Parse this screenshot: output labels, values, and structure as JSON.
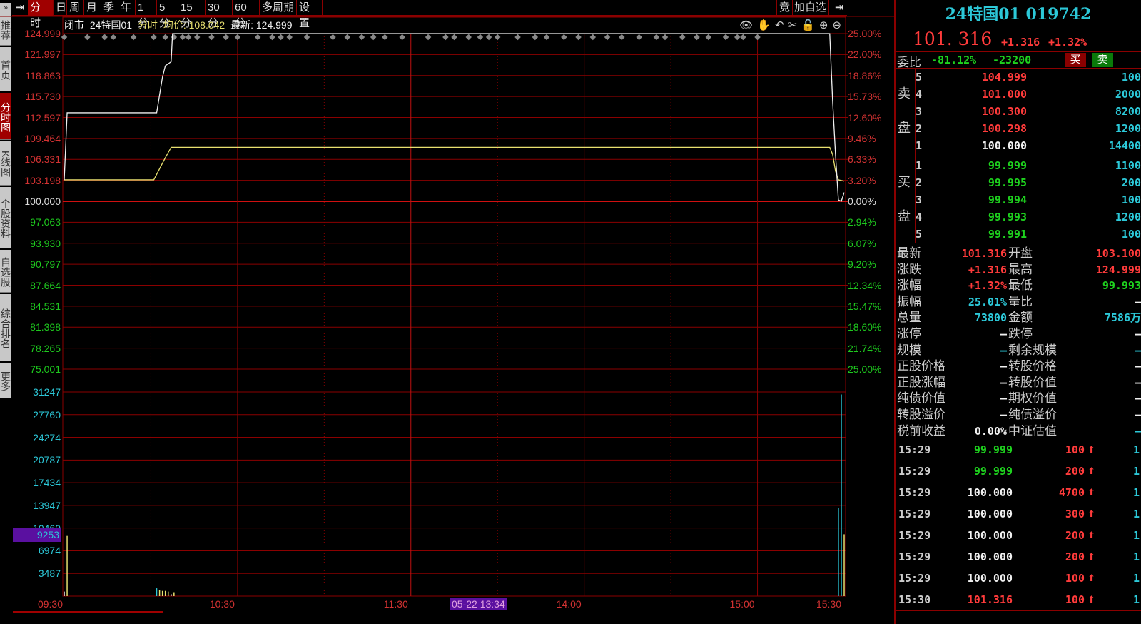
{
  "sidebar": {
    "top_glyph": "»",
    "items": [
      {
        "label": "推荐"
      },
      {
        "label": "首页"
      },
      {
        "label": "分时图",
        "active": true
      },
      {
        "label": "K线图"
      },
      {
        "label": "个股资料"
      },
      {
        "label": "自选股"
      },
      {
        "label": "综合排名"
      },
      {
        "label": "更多"
      }
    ]
  },
  "toolbar": {
    "pin_glyph": "⇥",
    "tabs": [
      "分时",
      "日",
      "周",
      "月",
      "季",
      "年",
      "1分",
      "5分",
      "15分",
      "30分",
      "60分",
      "多周期",
      "设置"
    ],
    "active": 0,
    "right": [
      "竞",
      "加自选"
    ],
    "end_glyph": "⇥"
  },
  "chart_header": {
    "status": "闭市",
    "name": "24特国01",
    "mode": "分时",
    "avg_label": "均价:",
    "avg": "108.042",
    "last_label": "最新:",
    "last": "124.999"
  },
  "chart_icons": [
    "eye-icon",
    "hand-icon",
    "undo-icon",
    "scissors-icon",
    "lock-icon",
    "zoom-in-icon",
    "zoom-out-icon"
  ],
  "chart_data": {
    "type": "line",
    "prev_close": 100.0,
    "price_axis": [
      "124.999",
      "121.997",
      "118.863",
      "115.730",
      "112.597",
      "109.464",
      "106.331",
      "103.198",
      "100.000",
      "97.063",
      "93.930",
      "90.797",
      "87.664",
      "84.531",
      "81.398",
      "78.265",
      "75.001"
    ],
    "pct_axis": [
      "25.00%",
      "22.00%",
      "18.86%",
      "15.73%",
      "12.60%",
      "9.46%",
      "6.33%",
      "3.20%",
      "0.00%",
      "2.94%",
      "6.07%",
      "9.20%",
      "12.34%",
      "15.47%",
      "18.60%",
      "21.74%",
      "25.00%"
    ],
    "volume_axis": [
      "31247",
      "27760",
      "24274",
      "20787",
      "17434",
      "13947",
      "10460",
      "6974",
      "3487"
    ],
    "time_labels": [
      {
        "t": "09:30",
        "m": 0
      },
      {
        "t": "10:30",
        "m": 60
      },
      {
        "t": "11:30",
        "m": 120
      },
      {
        "t": "14:00",
        "m": 180
      },
      {
        "t": "15:00",
        "m": 240
      },
      {
        "t": "15:30",
        "m": 270
      }
    ],
    "cursor": {
      "volume": "9253",
      "time": "05-22 13:34"
    },
    "price_series": {
      "name": "最新",
      "color": "#f0f0f0",
      "points": [
        [
          0,
          103.2
        ],
        [
          1,
          113.2
        ],
        [
          32,
          113.2
        ],
        [
          34,
          118.5
        ],
        [
          35,
          120.2
        ],
        [
          37,
          120.8
        ],
        [
          37.5,
          124.999
        ],
        [
          265,
          124.999
        ],
        [
          266,
          115
        ],
        [
          267,
          107
        ],
        [
          268,
          100.2
        ],
        [
          269,
          100.0
        ],
        [
          270,
          101.316
        ]
      ]
    },
    "avg_series": {
      "name": "均价",
      "color": "#e8e070",
      "points": [
        [
          0,
          103.2
        ],
        [
          31,
          103.2
        ],
        [
          35,
          106.5
        ],
        [
          37,
          108.042
        ],
        [
          265,
          108.042
        ],
        [
          266,
          107
        ],
        [
          267,
          104.5
        ],
        [
          268,
          103.2
        ],
        [
          270,
          103.0
        ]
      ]
    },
    "volume_bars": [
      [
        0,
        700,
        "#f0f0f0"
      ],
      [
        1,
        9253,
        "#e8e070"
      ],
      [
        32,
        1200,
        "#2cc8d8"
      ],
      [
        33,
        900,
        "#e8e070"
      ],
      [
        34,
        800,
        "#e8e070"
      ],
      [
        35,
        800,
        "#e8e070"
      ],
      [
        36,
        700,
        "#e8e070"
      ],
      [
        37,
        300,
        "#f0f0f0"
      ],
      [
        38,
        600,
        "#e8e070"
      ],
      [
        268,
        13500,
        "#2cc8d8"
      ],
      [
        269,
        31000,
        "#2cc8d8"
      ],
      [
        270,
        9500,
        "#e8e070"
      ]
    ]
  },
  "quote": {
    "title": "24特国01 019742",
    "price": "101. 316",
    "change": "+1.316",
    "pct": "+1.32%",
    "weibi_label": "委比",
    "weibi_pct": "-81.12%",
    "weibi_diff": "-23200",
    "buy_btn": "买",
    "sell_btn": "卖",
    "sell_label": [
      "卖",
      "盘"
    ],
    "buy_label": [
      "买",
      "盘"
    ],
    "asks": [
      {
        "lvl": "5",
        "price": "104.999",
        "vol": "100"
      },
      {
        "lvl": "4",
        "price": "101.000",
        "vol": "2000"
      },
      {
        "lvl": "3",
        "price": "100.300",
        "vol": "8200"
      },
      {
        "lvl": "2",
        "price": "100.298",
        "vol": "1200"
      },
      {
        "lvl": "1",
        "price": "100.000",
        "vol": "14400"
      }
    ],
    "bids": [
      {
        "lvl": "1",
        "price": "99.999",
        "vol": "1100"
      },
      {
        "lvl": "2",
        "price": "99.995",
        "vol": "200"
      },
      {
        "lvl": "3",
        "price": "99.994",
        "vol": "100"
      },
      {
        "lvl": "4",
        "price": "99.993",
        "vol": "1200"
      },
      {
        "lvl": "5",
        "price": "99.991",
        "vol": "100"
      }
    ],
    "stats": [
      {
        "l1": "最新",
        "v1": "101.316",
        "c1": "red",
        "l2": "开盘",
        "v2": "103.100",
        "c2": "red"
      },
      {
        "l1": "涨跌",
        "v1": "+1.316",
        "c1": "red",
        "l2": "最高",
        "v2": "124.999",
        "c2": "red"
      },
      {
        "l1": "涨幅",
        "v1": "+1.32%",
        "c1": "red",
        "l2": "最低",
        "v2": "99.993",
        "c2": "green"
      },
      {
        "l1": "振幅",
        "v1": "25.01%",
        "c1": "cyan",
        "l2": "量比",
        "v2": "–",
        "c2": "white"
      },
      {
        "l1": "总量",
        "v1": "73800",
        "c1": "cyan",
        "l2": "金额",
        "v2": "7586万",
        "c2": "cyan"
      },
      {
        "l1": "涨停",
        "v1": "–",
        "c1": "white",
        "l2": "跌停",
        "v2": "–",
        "c2": "white"
      },
      {
        "l1": "规模",
        "v1": "–",
        "c1": "cyan",
        "l2": "剩余规模",
        "v2": "–",
        "c2": "cyan"
      },
      {
        "l1": "正股价格",
        "v1": "–",
        "c1": "white",
        "l2": "转股价格",
        "v2": "–",
        "c2": "white"
      },
      {
        "l1": "正股涨幅",
        "v1": "–",
        "c1": "white",
        "l2": "转股价值",
        "v2": "–",
        "c2": "white"
      },
      {
        "l1": "纯债价值",
        "v1": "–",
        "c1": "white",
        "l2": "期权价值",
        "v2": "–",
        "c2": "white"
      },
      {
        "l1": "转股溢价",
        "v1": "–",
        "c1": "white",
        "l2": "纯债溢价",
        "v2": "–",
        "c2": "white"
      },
      {
        "l1": "税前收益",
        "v1": "0.00%",
        "c1": "white",
        "l2": "中证估值",
        "v2": "–",
        "c2": "cyan"
      }
    ],
    "trades": [
      {
        "time": "15:29",
        "price": "99.999",
        "pc": "green",
        "vol": "100",
        "n": "1"
      },
      {
        "time": "15:29",
        "price": "99.999",
        "pc": "green",
        "vol": "200",
        "n": "1"
      },
      {
        "time": "15:29",
        "price": "100.000",
        "pc": "white",
        "vol": "4700",
        "n": "1"
      },
      {
        "time": "15:29",
        "price": "100.000",
        "pc": "white",
        "vol": "300",
        "n": "1"
      },
      {
        "time": "15:29",
        "price": "100.000",
        "pc": "white",
        "vol": "200",
        "n": "1"
      },
      {
        "time": "15:29",
        "price": "100.000",
        "pc": "white",
        "vol": "200",
        "n": "1"
      },
      {
        "time": "15:29",
        "price": "100.000",
        "pc": "white",
        "vol": "100",
        "n": "1"
      },
      {
        "time": "15:30",
        "price": "101.316",
        "pc": "red",
        "vol": "100",
        "n": "1"
      }
    ],
    "trade_arrow": "⬆"
  }
}
